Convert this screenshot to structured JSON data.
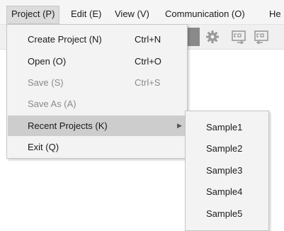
{
  "menubar": {
    "items": [
      {
        "label": "Project (P)"
      },
      {
        "label": "Edit (E)"
      },
      {
        "label": "View (V)"
      },
      {
        "label": "Communication (O)"
      },
      {
        "label": "He"
      }
    ]
  },
  "toolbar": {
    "icons": [
      "gear-icon",
      "sd-import-icon",
      "sd-export-icon"
    ],
    "icon_color": "#9a9a9a"
  },
  "project_menu": {
    "items": [
      {
        "label": "Create Project (N)",
        "shortcut": "Ctrl+N",
        "enabled": true
      },
      {
        "label": "Open (O)",
        "shortcut": "Ctrl+O",
        "enabled": true
      },
      {
        "label": "Save (S)",
        "shortcut": "Ctrl+S",
        "enabled": false
      },
      {
        "label": "Save As (A)",
        "shortcut": "",
        "enabled": false
      },
      {
        "label": "Recent Projects (K)",
        "shortcut": "",
        "enabled": true,
        "submenu_arrow": "▶"
      },
      {
        "label": "Exit (Q)",
        "shortcut": "",
        "enabled": true
      }
    ]
  },
  "recent_projects": {
    "items": [
      {
        "label": "Sample1"
      },
      {
        "label": "Sample2"
      },
      {
        "label": "Sample3"
      },
      {
        "label": "Sample4"
      },
      {
        "label": "Sample5"
      }
    ]
  },
  "colors": {
    "highlight": "#cdcdcd",
    "disabled_text": "#8a8a8a"
  }
}
